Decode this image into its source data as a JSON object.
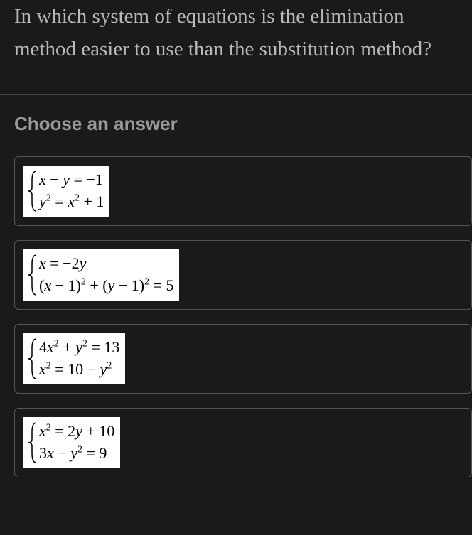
{
  "question": {
    "text": "In which system of equations is the elimination method easier to use than the substitution method?"
  },
  "prompt": "Choose an answer",
  "options": {
    "a": {
      "eq1_html": "<span>x</span> <span class='eq-normal'>−</span> <span>y</span> <span class='eq-normal'>= −1</span>",
      "eq2_html": "<span>y</span><sup>2</sup> <span class='eq-normal'>=</span> <span>x</span><sup>2</sup> <span class='eq-normal'>+ 1</span>"
    },
    "b": {
      "eq1_html": "<span>x</span> <span class='eq-normal'>= −2</span><span>y</span>",
      "eq2_html": "<span class='eq-normal'>(</span><span>x</span> <span class='eq-normal'>− 1)</span><sup>2</sup> <span class='eq-normal'>+ (</span><span>y</span> <span class='eq-normal'>− 1)</span><sup>2</sup> <span class='eq-normal'>= 5</span>"
    },
    "c": {
      "eq1_html": "<span class='eq-normal'>4</span><span>x</span><sup>2</sup> <span class='eq-normal'>+</span> <span>y</span><sup>2</sup> <span class='eq-normal'>= 13</span>",
      "eq2_html": "<span>x</span><sup>2</sup> <span class='eq-normal'>= 10 −</span> <span>y</span><sup>2</sup>"
    },
    "d": {
      "eq1_html": "<span>x</span><sup>2</sup> <span class='eq-normal'>= 2</span><span>y</span> <span class='eq-normal'>+ 10</span>",
      "eq2_html": "<span class='eq-normal'>3</span><span>x</span> <span class='eq-normal'>−</span> <span>y</span><sup>2</sup> <span class='eq-normal'>= 9</span>"
    }
  }
}
